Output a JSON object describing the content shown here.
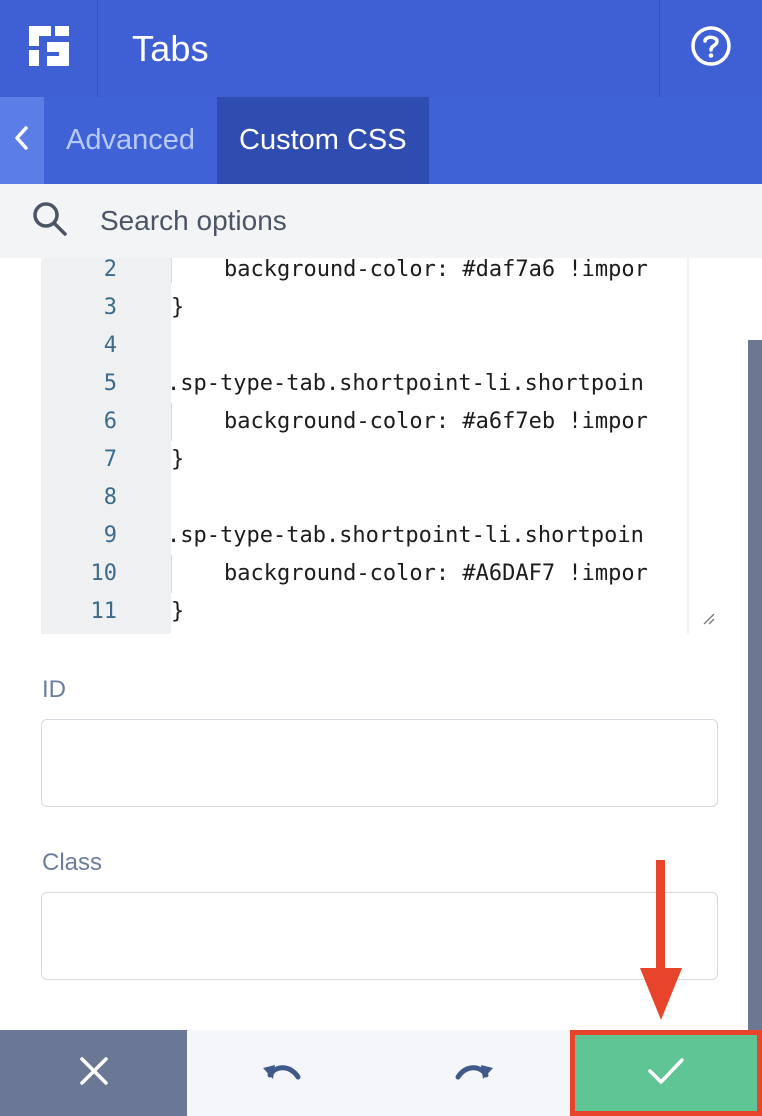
{
  "header": {
    "title": "Tabs",
    "logo_icon": "shortpoint-logo-icon",
    "help_icon": "help-circle-icon"
  },
  "tabs": {
    "back_icon": "chevron-left-icon",
    "items": [
      {
        "label": "Advanced",
        "active": false
      },
      {
        "label": "Custom CSS",
        "active": true
      }
    ]
  },
  "search": {
    "placeholder": "Search options",
    "value": ""
  },
  "editor": {
    "lines": [
      {
        "number": "2",
        "text": "    background-color: #daf7a6 !impor"
      },
      {
        "number": "3",
        "text": "}"
      },
      {
        "number": "4",
        "text": ""
      },
      {
        "number": "5",
        "text": ".sp-type-tab.shortpoint-li.shortpoin"
      },
      {
        "number": "6",
        "text": "    background-color: #a6f7eb !impor"
      },
      {
        "number": "7",
        "text": "}"
      },
      {
        "number": "8",
        "text": ""
      },
      {
        "number": "9",
        "text": ".sp-type-tab.shortpoint-li.shortpoin"
      },
      {
        "number": "10",
        "text": "    background-color: #A6DAF7 !impor"
      },
      {
        "number": "11",
        "text": "}"
      }
    ]
  },
  "fields": {
    "id": {
      "label": "ID",
      "value": ""
    },
    "class": {
      "label": "Class",
      "value": ""
    }
  },
  "footer": {
    "close_icon": "close-icon",
    "undo_icon": "undo-icon",
    "redo_icon": "redo-icon",
    "save_icon": "check-icon"
  },
  "colors": {
    "header_bg": "#3f5fd4",
    "tab_active_bg": "#2f4cb0",
    "save_green": "#5fc595",
    "annotation_red": "#e8432b"
  }
}
